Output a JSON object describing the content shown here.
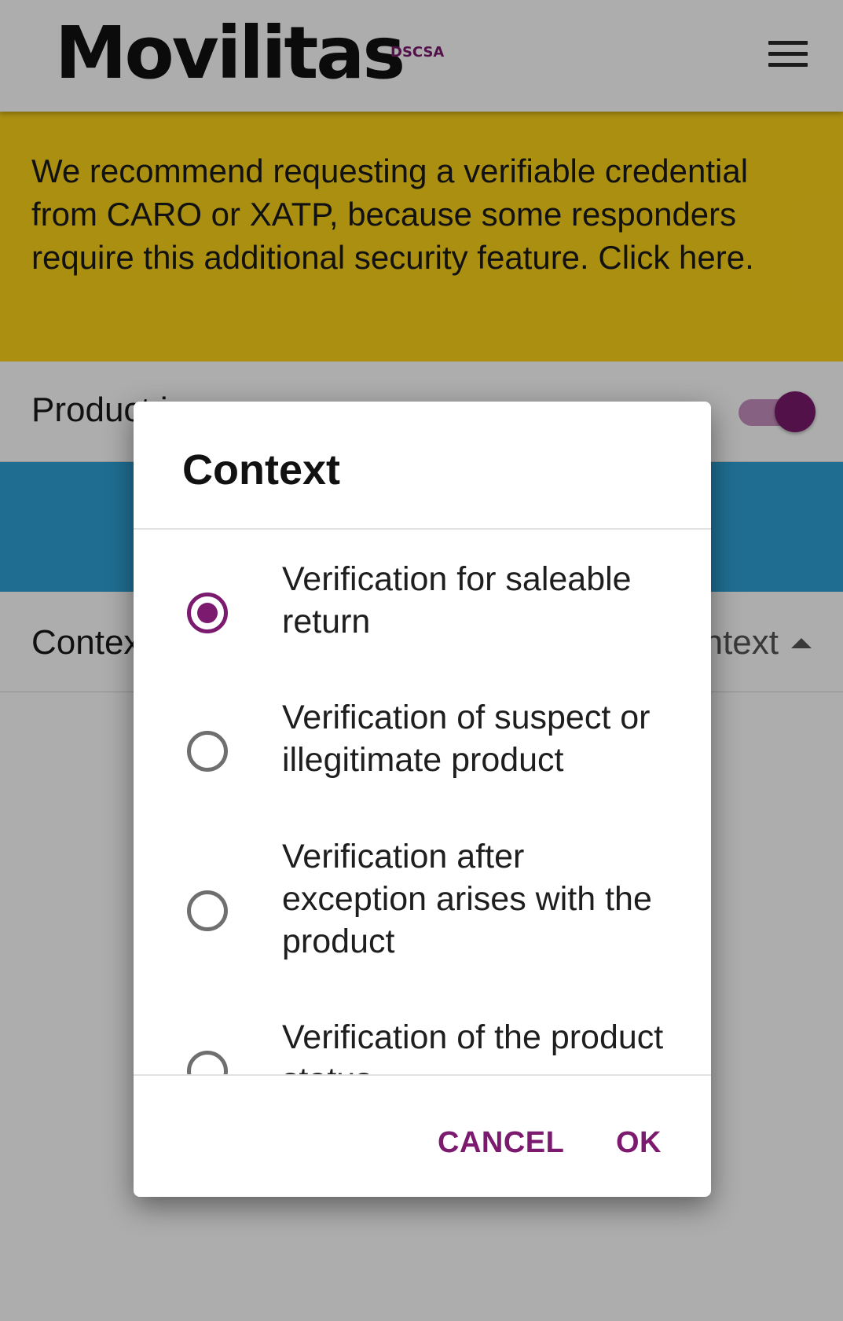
{
  "header": {
    "logo": "Movilitas",
    "logo_sub": "DSCSA",
    "menu_icon": "menu-icon"
  },
  "banner": {
    "text": "We recommend requesting a verifiable credential from CARO or XATP, because some responders require this additional security feature. Click here."
  },
  "product_row": {
    "label": "Product i",
    "toggle_on": true
  },
  "context_row": {
    "label": "Contex",
    "value": "ntext"
  },
  "dialog": {
    "title": "Context",
    "options": [
      {
        "label": "Verification for saleable return",
        "selected": true
      },
      {
        "label": "Verification of suspect or illegitimate product",
        "selected": false
      },
      {
        "label": "Verification after exception arises with the product",
        "selected": false
      },
      {
        "label": "Verification of the product status",
        "selected": false
      }
    ],
    "cancel_label": "CANCEL",
    "ok_label": "OK"
  },
  "colors": {
    "accent": "#7b1a6e",
    "banner": "#fbd31a",
    "blue_band": "#2ea2d8"
  }
}
